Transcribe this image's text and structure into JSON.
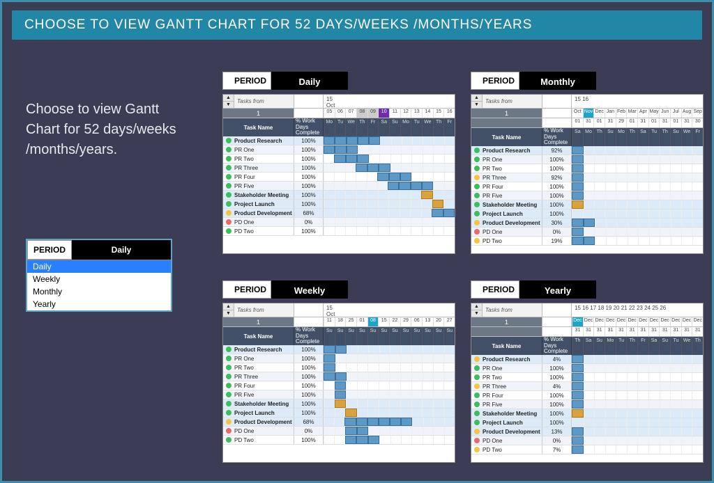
{
  "header": "CHOOSE TO VIEW GANTT CHART FOR 52 DAYS/WEEKS /MONTHS/YEARS",
  "intro": "Choose to view Gantt Chart for 52 days/weeks /months/years.",
  "period_label": "PERIOD",
  "dropdown": {
    "value": "Daily",
    "options": [
      "Daily",
      "Weekly",
      "Monthly",
      "Yearly"
    ]
  },
  "common": {
    "tasks_from": "Tasks from",
    "page_no": "1",
    "task_name_h": "Task Name",
    "work_days_h": "% Work Days Complete"
  },
  "panels": {
    "daily": {
      "period_value": "Daily",
      "year_label": "15",
      "month_label": "Oct",
      "day_numbers": [
        "05",
        "06",
        "07",
        "08",
        "09",
        "10",
        "11",
        "12",
        "13",
        "14",
        "15",
        "16"
      ],
      "highlight_idx": 5,
      "highlight_class": "hi",
      "grey_idx": [
        3,
        4
      ],
      "dow": [
        "Mo",
        "Tu",
        "We",
        "Th",
        "Fr",
        "Sa",
        "Su",
        "Mo",
        "Tu",
        "We",
        "Th",
        "Fr"
      ],
      "tasks": [
        {
          "n": "Product Research",
          "b": true,
          "dot": "g",
          "pct": "100%",
          "bar": [
            0,
            5
          ]
        },
        {
          "n": "PR One",
          "dot": "g",
          "pct": "100%",
          "bar": [
            0,
            3
          ]
        },
        {
          "n": "PR Two",
          "dot": "g",
          "pct": "100%",
          "bar": [
            1,
            4
          ]
        },
        {
          "n": "PR Three",
          "dot": "g",
          "pct": "100%",
          "bar": [
            3,
            6
          ]
        },
        {
          "n": "PR Four",
          "dot": "g",
          "pct": "100%",
          "bar": [
            5,
            8
          ]
        },
        {
          "n": "PR Five",
          "dot": "g",
          "pct": "100%",
          "bar": [
            6,
            10
          ]
        },
        {
          "n": "Stakeholder Meeting",
          "b": true,
          "dot": "g",
          "pct": "100%",
          "obar": [
            9,
            10
          ]
        },
        {
          "n": "Project Launch",
          "b": true,
          "dot": "g",
          "pct": "100%",
          "obar": [
            10,
            11
          ]
        },
        {
          "n": "Product Development",
          "b": true,
          "dot": "y",
          "pct": "68%",
          "bar": [
            10,
            12
          ]
        },
        {
          "n": "PD One",
          "dot": "r",
          "pct": "0%"
        },
        {
          "n": "PD Two",
          "dot": "g",
          "pct": "100%"
        }
      ]
    },
    "monthly": {
      "period_value": "Monthly",
      "year_label": "15       16",
      "month_label": "",
      "day_numbers": [
        "Oct",
        "Nov",
        "Dec",
        "Jan",
        "Feb",
        "Mar",
        "Apr",
        "May",
        "Jun",
        "Jul",
        "Aug",
        "Sep"
      ],
      "day_numbers2": [
        "01",
        "31",
        "01",
        "31",
        "29",
        "01",
        "31",
        "01",
        "31",
        "01",
        "31",
        "30"
      ],
      "highlight_idx": 1,
      "highlight_class": "hib",
      "dow": [
        "Sa",
        "Mo",
        "Th",
        "Su",
        "Mo",
        "Th",
        "Sa",
        "Tu",
        "Th",
        "Su",
        "We",
        "Fr"
      ],
      "tasks": [
        {
          "n": "Product Research",
          "b": true,
          "dot": "g",
          "pct": "92%",
          "bar": [
            0,
            1
          ]
        },
        {
          "n": "PR One",
          "dot": "g",
          "pct": "100%",
          "bar": [
            0,
            1
          ]
        },
        {
          "n": "PR Two",
          "dot": "g",
          "pct": "100%",
          "bar": [
            0,
            1
          ]
        },
        {
          "n": "PR Three",
          "dot": "y",
          "pct": "92%",
          "bar": [
            0,
            1
          ]
        },
        {
          "n": "PR Four",
          "dot": "g",
          "pct": "100%",
          "bar": [
            0,
            1
          ]
        },
        {
          "n": "PR Five",
          "dot": "g",
          "pct": "100%",
          "bar": [
            0,
            1
          ]
        },
        {
          "n": "Stakeholder Meeting",
          "b": true,
          "dot": "g",
          "pct": "100%",
          "obar": [
            0,
            1
          ]
        },
        {
          "n": "Project Launch",
          "b": true,
          "dot": "g",
          "pct": "100%"
        },
        {
          "n": "Product Development",
          "b": true,
          "dot": "y",
          "pct": "30%",
          "bar": [
            0,
            2
          ]
        },
        {
          "n": "PD One",
          "dot": "r",
          "pct": "0%",
          "bar": [
            0,
            1
          ]
        },
        {
          "n": "PD Two",
          "dot": "y",
          "pct": "19%",
          "bar": [
            0,
            2
          ]
        }
      ]
    },
    "weekly": {
      "period_value": "Weekly",
      "year_label": "15",
      "month_label": "Oct",
      "day_numbers": [
        "11",
        "18",
        "25",
        "01",
        "08",
        "15",
        "22",
        "29",
        "06",
        "13",
        "20",
        "27"
      ],
      "highlight_idx": 4,
      "highlight_class": "hib",
      "dow": [
        "Su",
        "Su",
        "Su",
        "Su",
        "Su",
        "Su",
        "Su",
        "Su",
        "Su",
        "Su",
        "Su",
        "Su"
      ],
      "tasks": [
        {
          "n": "Product Research",
          "b": true,
          "dot": "g",
          "pct": "100%",
          "bar": [
            0,
            2
          ]
        },
        {
          "n": "PR One",
          "dot": "g",
          "pct": "100%",
          "bar": [
            0,
            1
          ]
        },
        {
          "n": "PR Two",
          "dot": "g",
          "pct": "100%",
          "bar": [
            0,
            1
          ]
        },
        {
          "n": "PR Three",
          "dot": "g",
          "pct": "100%",
          "bar": [
            0,
            2
          ]
        },
        {
          "n": "PR Four",
          "dot": "g",
          "pct": "100%",
          "bar": [
            1,
            2
          ]
        },
        {
          "n": "PR Five",
          "dot": "g",
          "pct": "100%",
          "bar": [
            1,
            2
          ]
        },
        {
          "n": "Stakeholder Meeting",
          "b": true,
          "dot": "g",
          "pct": "100%",
          "obar": [
            1,
            2
          ]
        },
        {
          "n": "Project Launch",
          "b": true,
          "dot": "g",
          "pct": "100%",
          "obar": [
            2,
            3
          ]
        },
        {
          "n": "Product Development",
          "b": true,
          "dot": "y",
          "pct": "68%",
          "bar": [
            2,
            8
          ]
        },
        {
          "n": "PD One",
          "dot": "r",
          "pct": "0%",
          "bar": [
            2,
            4
          ]
        },
        {
          "n": "PD Two",
          "dot": "g",
          "pct": "100%",
          "bar": [
            2,
            5
          ]
        }
      ]
    },
    "yearly": {
      "period_value": "Yearly",
      "year_label": "15  16  17  18  19  20  21  22  23  24  25  26",
      "month_label": "",
      "day_numbers": [
        "Dec",
        "Dec",
        "Dec",
        "Dec",
        "Dec",
        "Dec",
        "Dec",
        "Dec",
        "Dec",
        "Dec",
        "Dec",
        "Dec"
      ],
      "day_numbers2": [
        "31",
        "31",
        "31",
        "31",
        "31",
        "31",
        "31",
        "31",
        "31",
        "31",
        "31",
        "31"
      ],
      "highlight_idx": 0,
      "highlight_class": "hib",
      "dow": [
        "Th",
        "Sa",
        "Su",
        "Mo",
        "Tu",
        "Th",
        "Fr",
        "Sa",
        "Su",
        "Tu",
        "We",
        "Th"
      ],
      "tasks": [
        {
          "n": "Product Research",
          "b": true,
          "dot": "y",
          "pct": "4%",
          "bar": [
            0,
            1
          ]
        },
        {
          "n": "PR One",
          "dot": "g",
          "pct": "100%",
          "bar": [
            0,
            1
          ]
        },
        {
          "n": "PR Two",
          "dot": "g",
          "pct": "100%",
          "bar": [
            0,
            1
          ]
        },
        {
          "n": "PR Three",
          "dot": "y",
          "pct": "4%",
          "bar": [
            0,
            1
          ]
        },
        {
          "n": "PR Four",
          "dot": "g",
          "pct": "100%",
          "bar": [
            0,
            1
          ]
        },
        {
          "n": "PR Five",
          "dot": "g",
          "pct": "100%",
          "bar": [
            0,
            1
          ]
        },
        {
          "n": "Stakeholder Meeting",
          "b": true,
          "dot": "g",
          "pct": "100%",
          "obar": [
            0,
            1
          ]
        },
        {
          "n": "Project Launch",
          "b": true,
          "dot": "g",
          "pct": "100%"
        },
        {
          "n": "Product Development",
          "b": true,
          "dot": "y",
          "pct": "13%",
          "bar": [
            0,
            1
          ]
        },
        {
          "n": "PD One",
          "dot": "r",
          "pct": "0%",
          "bar": [
            0,
            1
          ]
        },
        {
          "n": "PD Two",
          "dot": "y",
          "pct": "7%",
          "bar": [
            0,
            1
          ]
        }
      ]
    }
  }
}
